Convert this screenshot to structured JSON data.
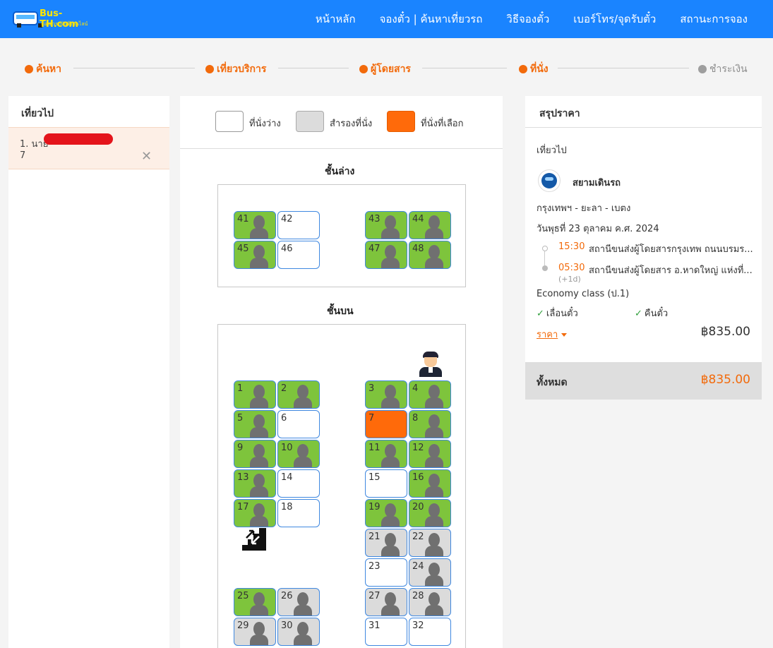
{
  "header": {
    "logo_brand": "Bus-TH.com",
    "logo_tagline": "จองตั๋วรถทัวร์ออนไลน์",
    "nav": [
      "หน้าหลัก",
      "จองตั๋ว | ค้นหาเที่ยวรถ",
      "วิธีจองตั๋ว",
      "เบอร์โทร/จุดรับตั๋ว",
      "สถานะการจอง"
    ]
  },
  "steps": [
    {
      "label": "ค้นหา",
      "active": true
    },
    {
      "label": "เที่ยวบริการ",
      "active": true
    },
    {
      "label": "ผู้โดยสาร",
      "active": true
    },
    {
      "label": "ที่นั่ง",
      "active": true
    },
    {
      "label": "ชำระเงิน",
      "active": false
    }
  ],
  "left_panel": {
    "title": "เที่ยวไป",
    "passenger_name": "1. นาย",
    "passenger_seat": "7"
  },
  "legend": {
    "empty": "ที่นั่งว่าง",
    "reserved": "สำรองที่นั่ง",
    "selected": "ที่นั่งที่เลือก"
  },
  "lower_deck": {
    "title": "ชั้นล่าง",
    "seats": [
      {
        "num": "41",
        "status": "occupied"
      },
      {
        "num": "42",
        "status": "empty"
      },
      {
        "num": "43",
        "status": "occupied"
      },
      {
        "num": "44",
        "status": "occupied"
      },
      {
        "num": "45",
        "status": "occupied"
      },
      {
        "num": "46",
        "status": "empty"
      },
      {
        "num": "47",
        "status": "occupied"
      },
      {
        "num": "48",
        "status": "occupied"
      }
    ]
  },
  "upper_deck": {
    "title": "ชั้นบน",
    "seats": [
      {
        "num": "1",
        "status": "occupied"
      },
      {
        "num": "2",
        "status": "occupied"
      },
      {
        "num": "3",
        "status": "occupied"
      },
      {
        "num": "4",
        "status": "occupied"
      },
      {
        "num": "5",
        "status": "occupied"
      },
      {
        "num": "6",
        "status": "empty"
      },
      {
        "num": "7",
        "status": "selected"
      },
      {
        "num": "8",
        "status": "occupied"
      },
      {
        "num": "9",
        "status": "occupied"
      },
      {
        "num": "10",
        "status": "occupied"
      },
      {
        "num": "11",
        "status": "occupied"
      },
      {
        "num": "12",
        "status": "occupied"
      },
      {
        "num": "13",
        "status": "occupied"
      },
      {
        "num": "14",
        "status": "empty"
      },
      {
        "num": "15",
        "status": "empty"
      },
      {
        "num": "16",
        "status": "occupied"
      },
      {
        "num": "17",
        "status": "occupied"
      },
      {
        "num": "18",
        "status": "empty"
      },
      {
        "num": "19",
        "status": "occupied"
      },
      {
        "num": "20",
        "status": "occupied"
      },
      {
        "num": "21",
        "status": "reserved"
      },
      {
        "num": "22",
        "status": "reserved"
      },
      {
        "num": "23",
        "status": "empty"
      },
      {
        "num": "24",
        "status": "reserved"
      },
      {
        "num": "25",
        "status": "occupied"
      },
      {
        "num": "26",
        "status": "reserved"
      },
      {
        "num": "27",
        "status": "reserved"
      },
      {
        "num": "28",
        "status": "reserved"
      },
      {
        "num": "29",
        "status": "reserved"
      },
      {
        "num": "30",
        "status": "reserved"
      },
      {
        "num": "31",
        "status": "empty"
      },
      {
        "num": "32",
        "status": "empty"
      }
    ]
  },
  "summary": {
    "title": "สรุปราคา",
    "direction": "เที่ยวไป",
    "operator": "สยามเดินรถ",
    "route": "กรุงเทพฯ - ยะลา - เบตง",
    "date": "วันพุธที่ 23 ตุลาคม ค.ศ. 2024",
    "depart_time": "15:30",
    "depart_station": "สถานีขนส่งผู้โดยสารกรุงเทพ ถนนบรมร...",
    "arrive_time": "05:30",
    "arrive_station": "สถานีขนส่งผู้โดยสาร อ.หาดใหญ่ แห่งที่...",
    "arrive_offset": "(+1d)",
    "class": "Economy class (ป.1)",
    "feature_1": "เลื่อนตั๋ว",
    "feature_2": "คืนตั๋ว",
    "price_label": "ราคา",
    "price": "฿835.00",
    "total_label": "ทั้งหมด",
    "total": "฿835.00"
  },
  "colors": {
    "header": "#1a84ff",
    "accent": "#f26a0b",
    "occupied": "#7ec43c",
    "reserved": "#dbdbdb",
    "selected": "#ff6a0a"
  }
}
